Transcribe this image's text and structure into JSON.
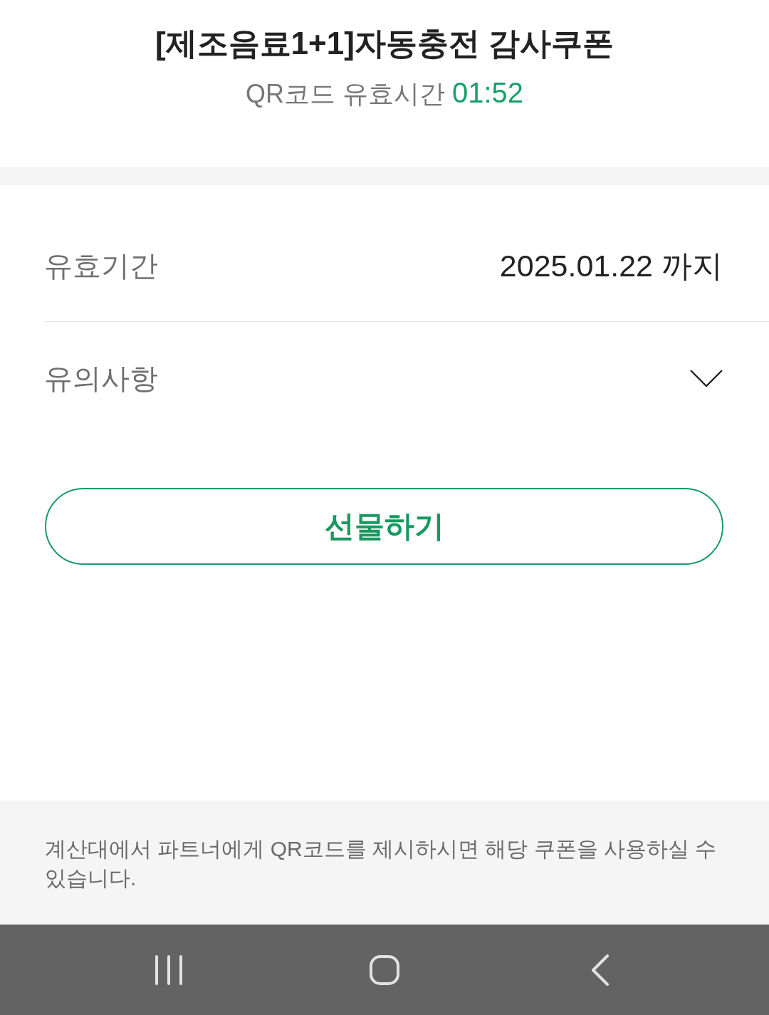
{
  "header": {
    "title": "[제조음료1+1]자동충전 감사쿠폰",
    "qr_validity": {
      "label": "QR코드 유효시간",
      "timer": "01:52"
    }
  },
  "details": [
    {
      "kind": "value",
      "label": "유효기간",
      "value": "2025.01.22 까지"
    },
    {
      "kind": "toggle",
      "label": "유의사항",
      "expanded": false
    }
  ],
  "gift_button": "선물하기",
  "notice": "계산대에서 파트너에게 QR코드를 제시하시면 해당 쿠폰을 사용하실 수 있습니다.",
  "nav_bar": [
    {
      "kind": "recents"
    },
    {
      "kind": "home"
    },
    {
      "kind": "back"
    }
  ]
}
